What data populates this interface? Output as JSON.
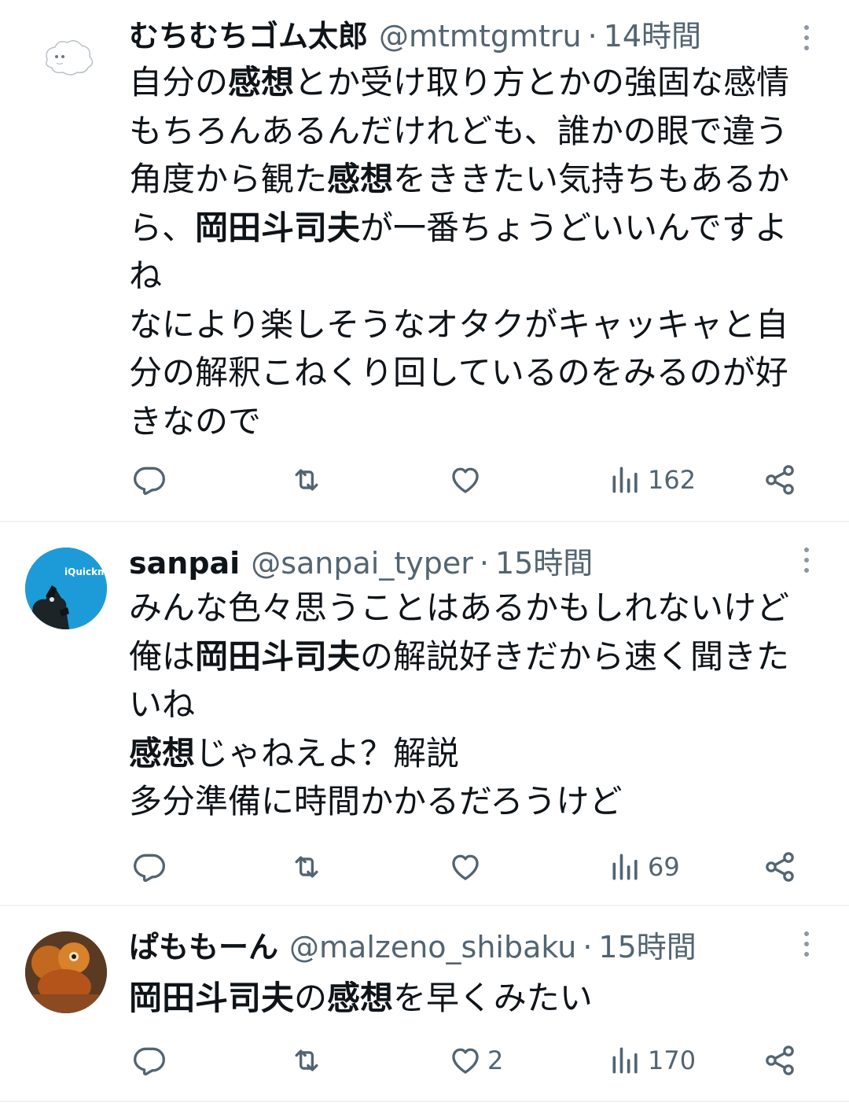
{
  "tweets": [
    {
      "name": "むちむちゴム太郎",
      "handle": "@mtmtgmtru",
      "time": "14時間",
      "lines": [
        [
          {
            "t": "自分の"
          },
          {
            "t": "感想",
            "b": true
          },
          {
            "t": "とか受け取り方とかの強固な感情"
          }
        ],
        [
          {
            "t": "もちろんあるんだけれども、誰かの眼で違う"
          }
        ],
        [
          {
            "t": "角度から観た"
          },
          {
            "t": "感想",
            "b": true
          },
          {
            "t": "をききたい気持ちもあるか"
          }
        ],
        [
          {
            "t": "ら、"
          },
          {
            "t": "岡田斗司夫",
            "b": true
          },
          {
            "t": "が一番ちょうどいいんですよ"
          }
        ],
        [
          {
            "t": "ね"
          }
        ],
        [
          {
            "t": "なにより楽しそうなオタクがキャッキャと自"
          }
        ],
        [
          {
            "t": "分の解釈こねくり回しているのをみるのが好"
          }
        ],
        [
          {
            "t": "きなので"
          }
        ]
      ],
      "likes": "",
      "views": "162"
    },
    {
      "name": "sanpai",
      "handle": "@sanpai_typer",
      "time": "15時間",
      "avatar_text": "iQuickm",
      "lines": [
        [
          {
            "t": "みんな色々思うことはあるかもしれないけど"
          }
        ],
        [
          {
            "t": "俺は"
          },
          {
            "t": "岡田斗司夫",
            "b": true
          },
          {
            "t": "の解説好きだから速く聞きた"
          }
        ],
        [
          {
            "t": "いね"
          }
        ],
        [
          {
            "t": "感想",
            "b": true
          },
          {
            "t": "じゃねえよ？解説"
          }
        ],
        [
          {
            "t": "多分準備に時間かかるだろうけど"
          }
        ]
      ],
      "likes": "",
      "views": "69"
    },
    {
      "name": "ぱももーん",
      "handle": "@malzeno_shibaku",
      "time": "15時間",
      "lines": [
        [
          {
            "t": "岡田斗司夫",
            "b": true
          },
          {
            "t": "の"
          },
          {
            "t": "感想",
            "b": true
          },
          {
            "t": "を早くみたい"
          }
        ]
      ],
      "likes": "2",
      "views": "170"
    }
  ],
  "separator": "·",
  "colors": {
    "text": "#0f1419",
    "muted": "#536471",
    "divider": "#eff3f4",
    "avatar2_bg": "#1d9bd8"
  },
  "icons": {
    "reply": "reply-icon",
    "retweet": "retweet-icon",
    "like": "heart-icon",
    "views": "views-chart-icon",
    "share": "share-icon",
    "more": "more-vertical-icon"
  }
}
